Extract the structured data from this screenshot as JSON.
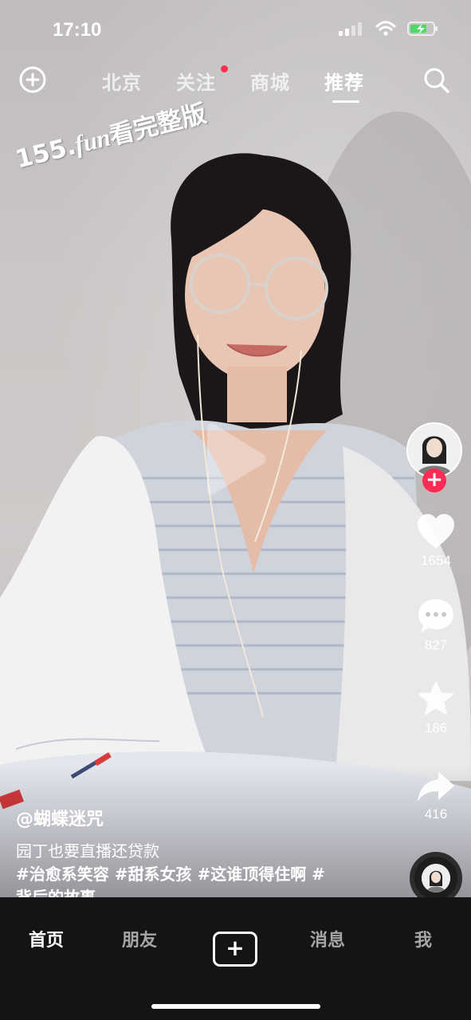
{
  "status": {
    "time": "17:10"
  },
  "top_nav": {
    "tabs": [
      {
        "label": "北京"
      },
      {
        "label": "关注"
      },
      {
        "label": "商城"
      },
      {
        "label": "推荐"
      }
    ],
    "active_tab": "推荐"
  },
  "video": {
    "watermark_prefix": "155.",
    "watermark_fun": "fun",
    "watermark_suffix": "看完整版"
  },
  "rail": {
    "likes": "1654",
    "comments": "827",
    "favorites": "186",
    "shares": "416"
  },
  "caption": {
    "author": "@蝴蝶迷咒",
    "line1": "园丁也要直播还贷款",
    "tags_line1": "#治愈系笑容 #甜系女孩 #这谁顶得住啊 #",
    "tags_line2": "背后的故事"
  },
  "tabbar": {
    "home": "首页",
    "friends": "朋友",
    "create": "+",
    "messages": "消息",
    "me": "我"
  },
  "colors": {
    "accent": "#fe2c55",
    "tabbar_bg": "#141414"
  }
}
